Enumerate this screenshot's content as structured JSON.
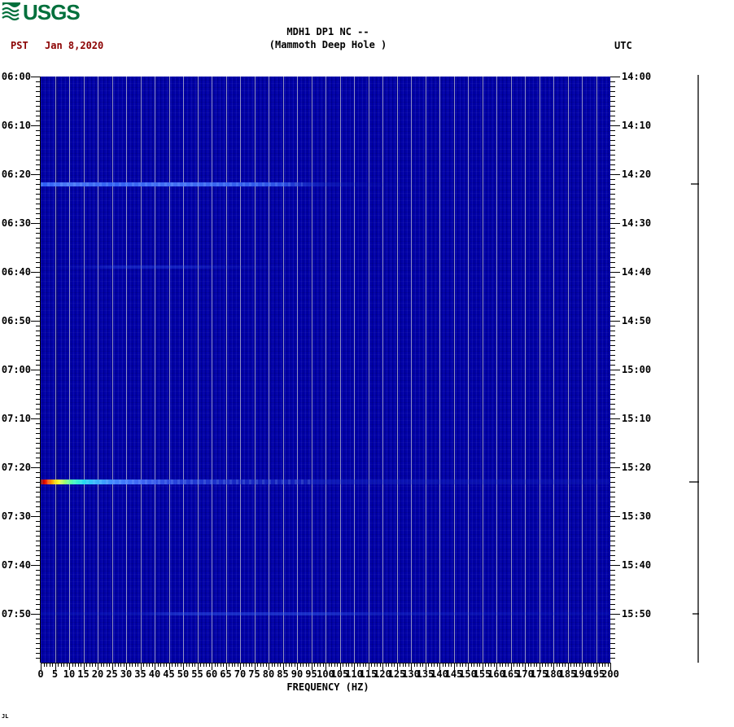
{
  "page": {
    "bottom_left_mark": "JL"
  },
  "logo": {
    "text": "USGS",
    "color": "#00703c"
  },
  "header": {
    "timezone_left": "PST",
    "date": "Jan 8,2020",
    "title_line1": "MDH1 DP1 NC --",
    "title_line2": "(Mammoth Deep Hole )",
    "timezone_right": "UTC",
    "date_color": "#8b0000"
  },
  "chart_data": {
    "type": "heatmap",
    "title": "MDH1 DP1 NC -- (Mammoth Deep Hole )",
    "station": "MDH1 DP1 NC",
    "station_name": "Mammoth Deep Hole",
    "date": "Jan 8,2020",
    "xlabel": "FREQUENCY (HZ)",
    "xlim": [
      0,
      200
    ],
    "x_major_tick_step_hz": 5,
    "x_minor_tick_step_hz": 1,
    "x_tick_labels": [
      "0",
      "5",
      "10",
      "15",
      "20",
      "25",
      "30",
      "35",
      "40",
      "45",
      "50",
      "55",
      "60",
      "65",
      "70",
      "75",
      "80",
      "85",
      "90",
      "95",
      "100",
      "105",
      "110",
      "115",
      "120",
      "125",
      "130",
      "135",
      "140",
      "145",
      "150",
      "155",
      "160",
      "165",
      "170",
      "175",
      "180",
      "185",
      "190",
      "195",
      "200"
    ],
    "time_axis": {
      "start_pst": "06:00",
      "end_pst": "08:00",
      "start_utc": "14:00",
      "end_utc": "16:00",
      "span_minutes": 120,
      "major_tick_step_min": 10,
      "minor_tick_step_min": 1
    },
    "left_time_labels_pst": [
      "06:00",
      "06:10",
      "06:20",
      "06:30",
      "06:40",
      "06:50",
      "07:00",
      "07:10",
      "07:20",
      "07:30",
      "07:40",
      "07:50"
    ],
    "right_time_labels_utc": [
      "14:00",
      "14:10",
      "14:20",
      "14:30",
      "14:40",
      "14:50",
      "15:00",
      "15:10",
      "15:20",
      "15:30",
      "15:40",
      "15:50"
    ],
    "grid": {
      "vertical_every_hz": 5,
      "color": "rgba(185,185,200,0.78)"
    },
    "background_color": "#0000a8",
    "artifact_dark_band_hz": 5.4,
    "events": [
      {
        "time_pst": "06:22",
        "time_utc": "14:22",
        "minutes_after_start": 22,
        "intensity": "moderate",
        "variant": "moderate",
        "max_visible_freq_hz": 120,
        "trace_tick": true,
        "description": "broadband burst, bright 0-90 Hz fading by ~120 Hz"
      },
      {
        "time_pst": "06:39",
        "time_utc": "14:39",
        "minutes_after_start": 39,
        "intensity": "faint",
        "variant": "faint-mid",
        "max_visible_freq_hz": 80,
        "trace_tick": false,
        "description": "very faint energy ~25-55 Hz"
      },
      {
        "time_pst": "07:23",
        "time_utc": "15:23",
        "minutes_after_start": 83,
        "intensity": "strong",
        "variant": "strong",
        "max_visible_freq_hz": 200,
        "trace_tick": true,
        "description": "strong event, red/orange/yellow head below ~10 Hz, cyan-blue tail across full band"
      },
      {
        "time_pst": "07:50",
        "time_utc": "15:50",
        "minutes_after_start": 110,
        "intensity": "faint",
        "variant": "faint-wide",
        "max_visible_freq_hz": 200,
        "trace_tick": true,
        "description": "faint band, strongest ~40-100 Hz"
      }
    ],
    "trace": {
      "position": "right-margin",
      "color": "#000000"
    }
  }
}
